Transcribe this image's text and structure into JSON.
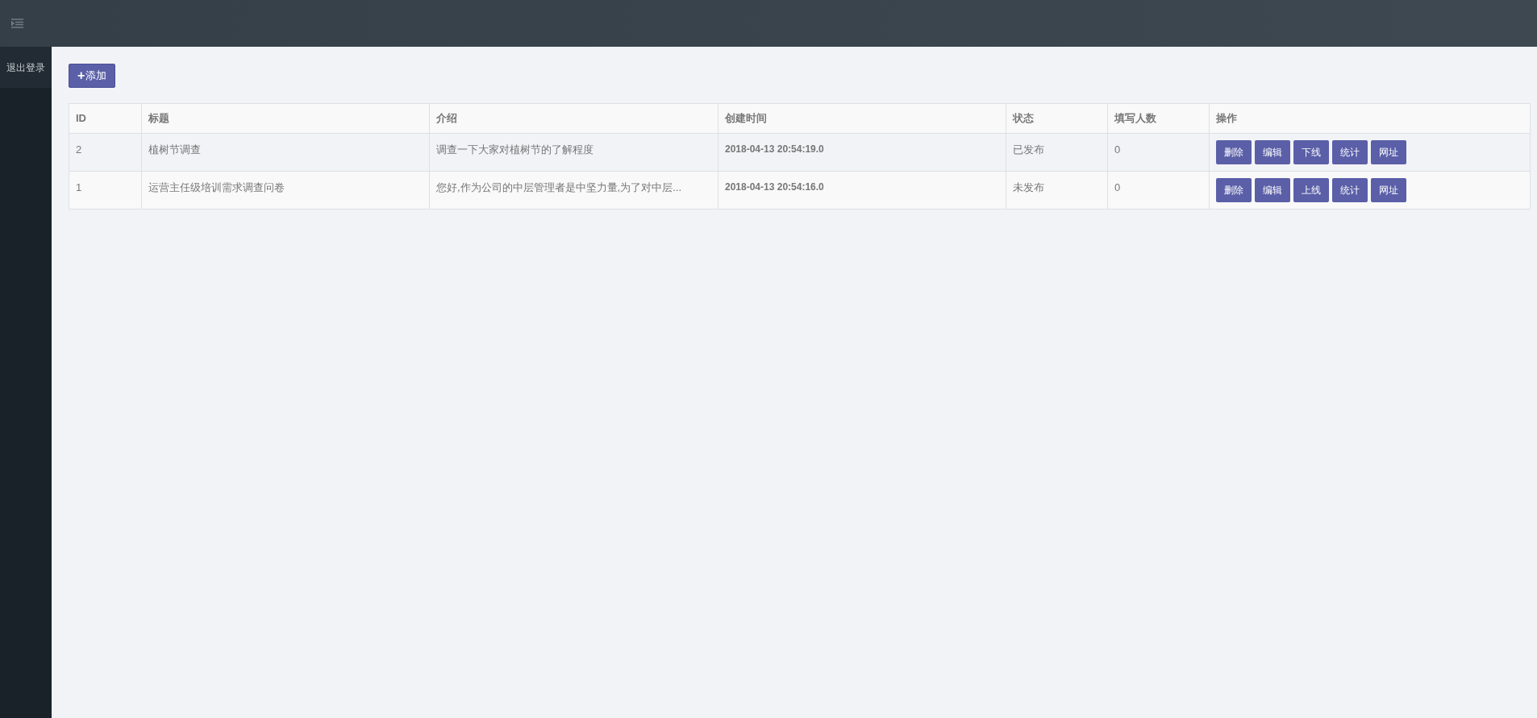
{
  "sidebar": {
    "items": [
      {
        "label": "退出登录"
      }
    ]
  },
  "add_button": {
    "icon": "+",
    "label": "添加"
  },
  "table": {
    "columns": [
      "ID",
      "标题",
      "介绍",
      "创建时间",
      "状态",
      "填写人数",
      "操作"
    ],
    "rows": [
      {
        "id": "2",
        "title": "植树节调查",
        "intro": "调查一下大家对植树节的了解程度",
        "created": "2018-04-13 20:54:19.0",
        "status": "已发布",
        "count": "0",
        "actions": [
          "删除",
          "编辑",
          "下线",
          "统计",
          "网址"
        ]
      },
      {
        "id": "1",
        "title": "运营主任级培训需求调查问卷",
        "intro": "您好,作为公司的中层管理者是中坚力量,为了对中层...",
        "created": "2018-04-13 20:54:16.0",
        "status": "未发布",
        "count": "0",
        "actions": [
          "删除",
          "编辑",
          "上线",
          "统计",
          "网址"
        ]
      }
    ]
  }
}
